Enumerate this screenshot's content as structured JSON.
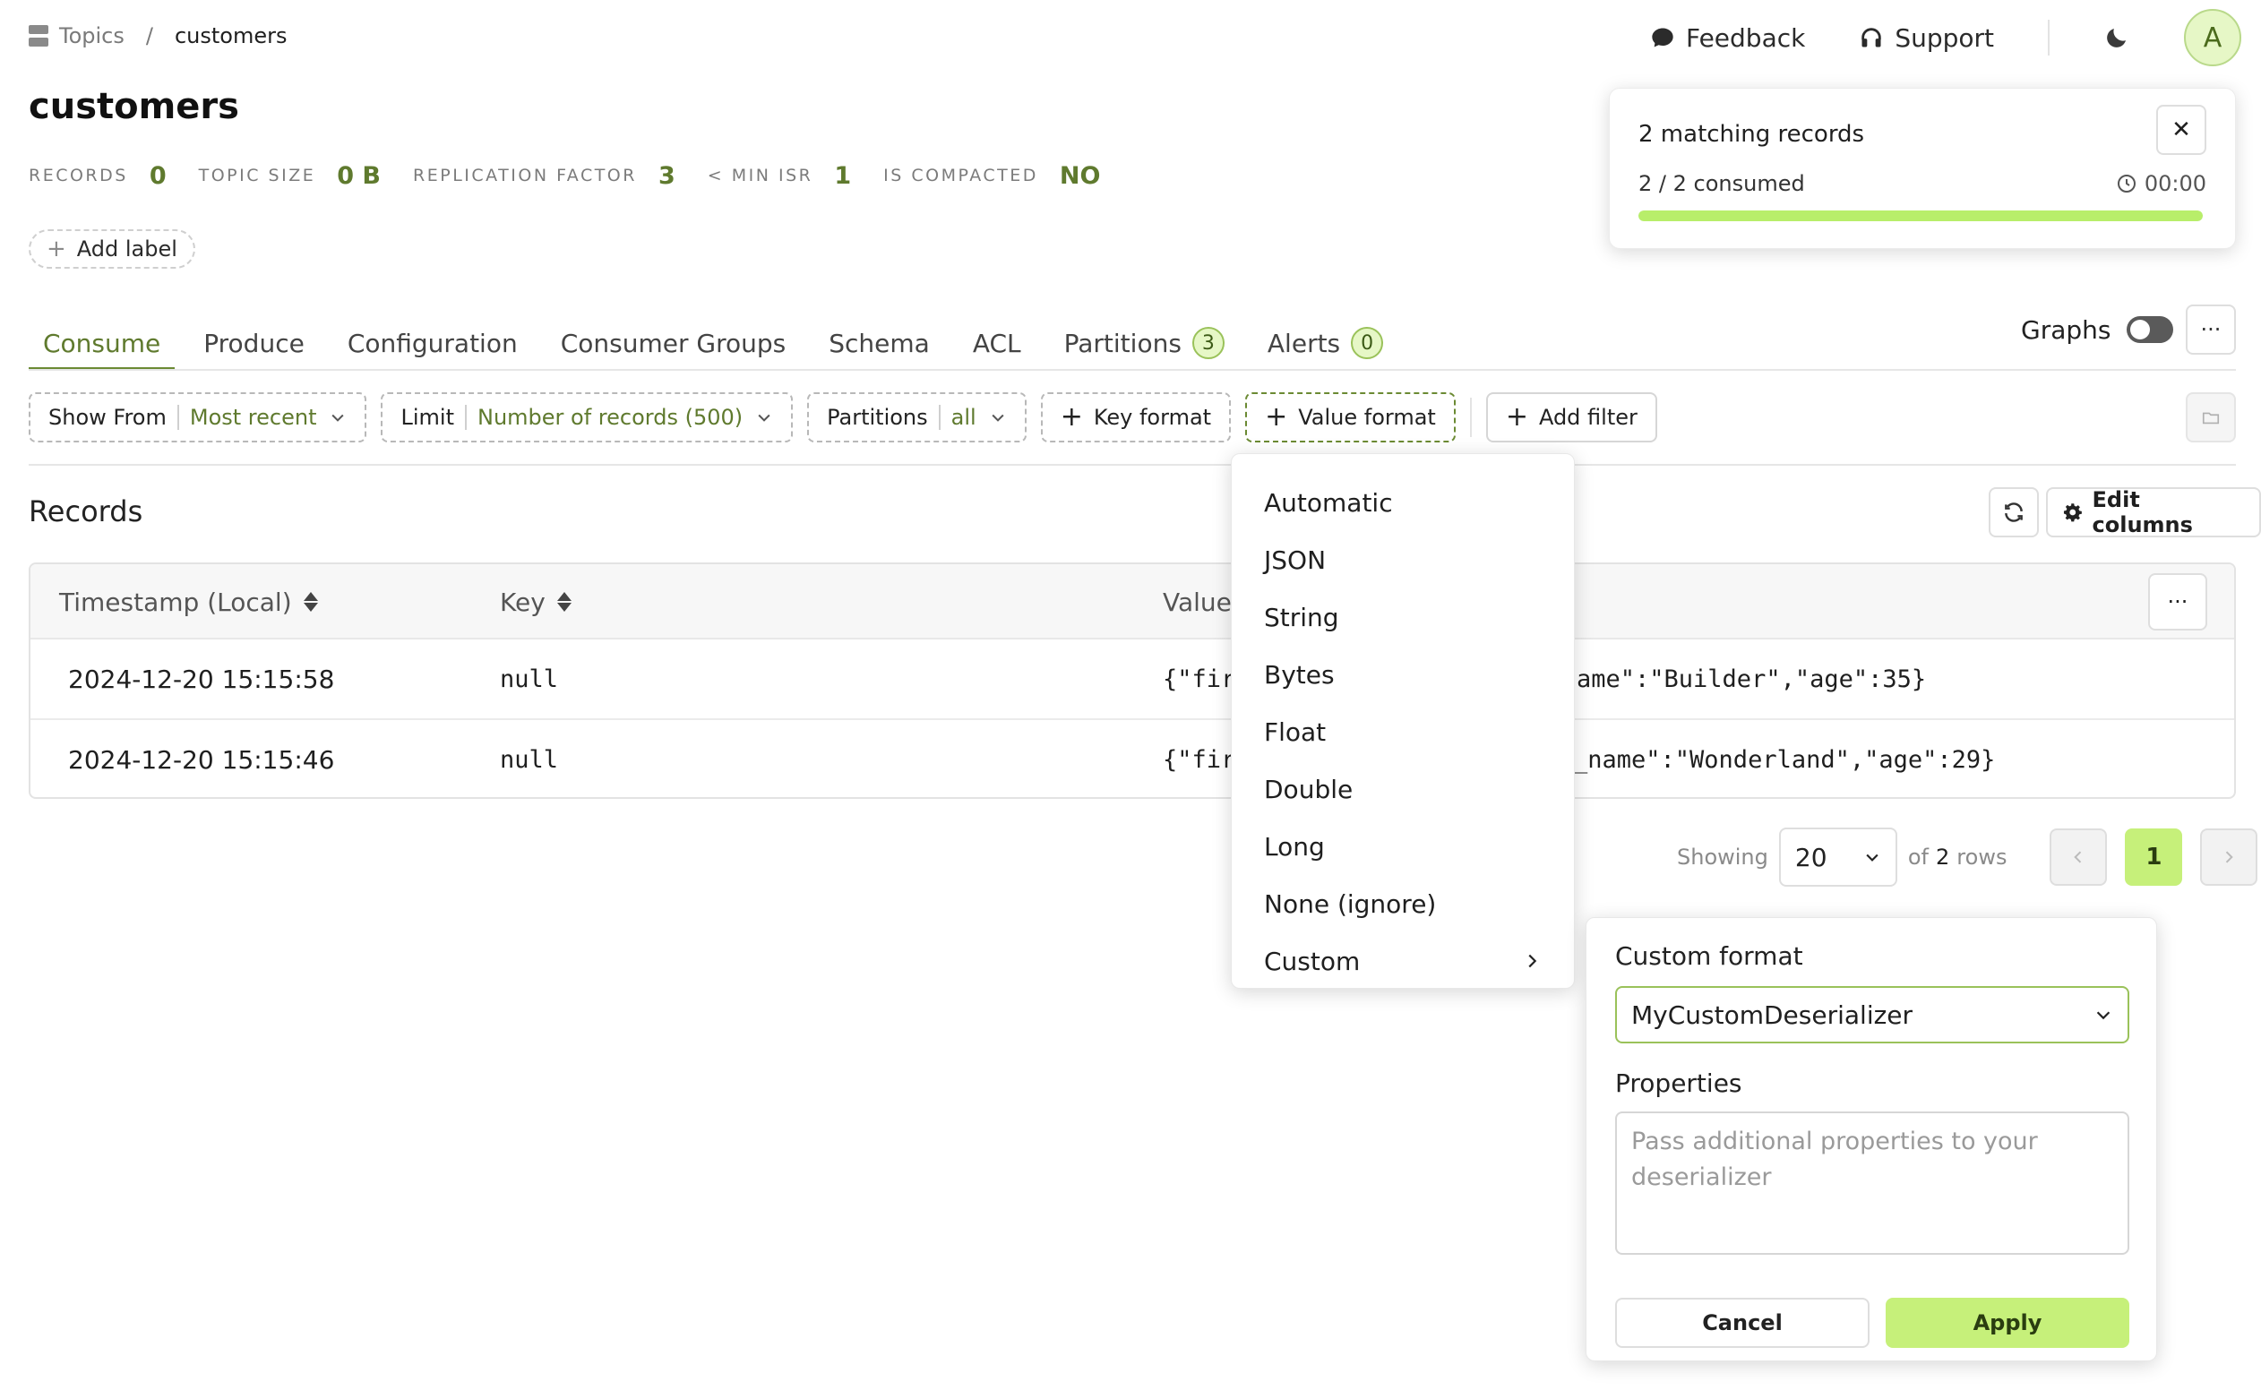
{
  "breadcrumb": {
    "root": "Topics",
    "separator": "/",
    "current": "customers"
  },
  "topnav": {
    "feedback": "Feedback",
    "support": "Support",
    "avatar_letter": "A"
  },
  "page_title": "customers",
  "stats": [
    {
      "label": "Records",
      "value": "0"
    },
    {
      "label": "Topic size",
      "value": "0 B"
    },
    {
      "label": "Replication factor",
      "value": "3"
    },
    {
      "label": "< Min ISR",
      "value": "1"
    },
    {
      "label": "Is compacted",
      "value": "NO"
    }
  ],
  "add_label": {
    "plus": "+",
    "text": "Add label"
  },
  "tabs": [
    {
      "label": "Consume",
      "active": true
    },
    {
      "label": "Produce"
    },
    {
      "label": "Configuration"
    },
    {
      "label": "Consumer Groups"
    },
    {
      "label": "Schema"
    },
    {
      "label": "ACL"
    },
    {
      "label": "Partitions",
      "badge": "3"
    },
    {
      "label": "Alerts",
      "badge": "0"
    }
  ],
  "graphs": {
    "label": "Graphs",
    "enabled": false
  },
  "more_label": "···",
  "filters": {
    "show_from": {
      "label": "Show From",
      "value": "Most recent"
    },
    "limit": {
      "label": "Limit",
      "value": "Number of records (500)"
    },
    "partitions": {
      "label": "Partitions",
      "value": "all"
    },
    "key_format": "Key format",
    "value_format": "Value format",
    "add_filter": "Add filter",
    "plus": "+"
  },
  "records": {
    "title": "Records",
    "edit_columns": "Edit columns",
    "columns": [
      "Timestamp (Local)",
      "Key",
      "Value"
    ],
    "rows": [
      {
        "timestamp": "2024-12-20 15:15:58",
        "key": "null",
        "value_start": "{\"fir",
        "value_end": "ame\":\"Builder\",\"age\":35}"
      },
      {
        "timestamp": "2024-12-20 15:15:46",
        "key": "null",
        "value_start": "{\"fir",
        "value_end": "_name\":\"Wonderland\",\"age\":29}"
      }
    ]
  },
  "pagination": {
    "showing": "Showing",
    "page_size": "20",
    "of": "of",
    "total": "2",
    "rows": "rows",
    "current_page": "1"
  },
  "notification": {
    "title": "2 matching records",
    "consumed": "2 / 2 consumed",
    "elapsed": "00:00",
    "progress": 1.0,
    "close": "✕"
  },
  "value_format_menu": [
    "Automatic",
    "JSON",
    "String",
    "Bytes",
    "Float",
    "Double",
    "Long",
    "None (ignore)",
    "Custom"
  ],
  "custom_format": {
    "title": "Custom format",
    "selected": "MyCustomDeserializer",
    "properties_label": "Properties",
    "properties_placeholder": "Pass additional properties to your deserializer",
    "cancel": "Cancel",
    "apply": "Apply"
  },
  "colors": {
    "accent": "#5f7a2e",
    "accent_light": "#c6f07a",
    "progress": "#b8ee6a"
  }
}
